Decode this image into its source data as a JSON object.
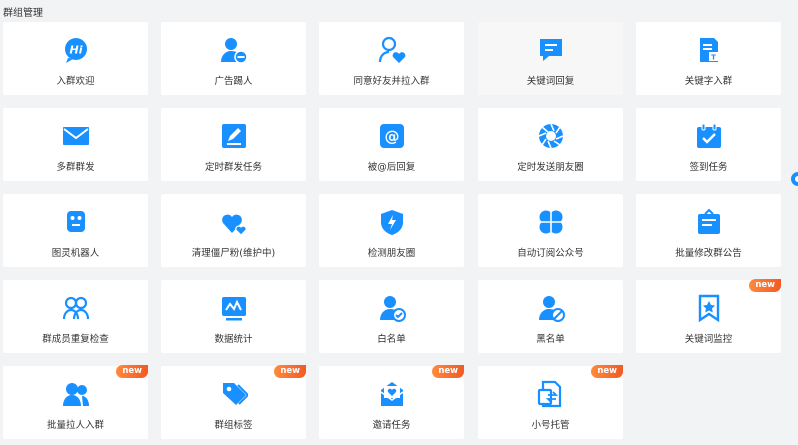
{
  "page": {
    "title": "群组管理"
  },
  "accent": "#1890ff",
  "badge_color": "#f15a24",
  "cards": [
    {
      "label": "入群欢迎",
      "icon": "hi-bubble-icon",
      "badge": ""
    },
    {
      "label": "广告踢人",
      "icon": "user-minus-icon",
      "badge": ""
    },
    {
      "label": "同意好友并拉入群",
      "icon": "user-heart-icon",
      "badge": ""
    },
    {
      "label": "关键词回复",
      "icon": "chat-bubble-icon",
      "badge": ""
    },
    {
      "label": "关键字入群",
      "icon": "document-text-icon",
      "badge": ""
    },
    {
      "label": "多群群发",
      "icon": "mail-icon",
      "badge": ""
    },
    {
      "label": "定时群发任务",
      "icon": "edit-square-icon",
      "badge": ""
    },
    {
      "label": "被@后回复",
      "icon": "at-sign-icon",
      "badge": ""
    },
    {
      "label": "定时发送朋友圈",
      "icon": "aperture-icon",
      "badge": ""
    },
    {
      "label": "签到任务",
      "icon": "calendar-check-icon",
      "badge": ""
    },
    {
      "label": "图灵机器人",
      "icon": "robot-icon",
      "badge": ""
    },
    {
      "label": "清理僵尸粉(维护中)",
      "icon": "hearts-icon",
      "badge": ""
    },
    {
      "label": "检测朋友圈",
      "icon": "shield-bolt-icon",
      "badge": ""
    },
    {
      "label": "自动订阅公众号",
      "icon": "clover-icon",
      "badge": ""
    },
    {
      "label": "批量修改群公告",
      "icon": "notice-board-icon",
      "badge": ""
    },
    {
      "label": "群成员重复检查",
      "icon": "users-group-icon",
      "badge": ""
    },
    {
      "label": "数据统计",
      "icon": "chart-monitor-icon",
      "badge": ""
    },
    {
      "label": "白名单",
      "icon": "user-check-icon",
      "badge": ""
    },
    {
      "label": "黑名单",
      "icon": "user-block-icon",
      "badge": ""
    },
    {
      "label": "关键词监控",
      "icon": "star-bookmark-icon",
      "badge": "new"
    },
    {
      "label": "批量拉人入群",
      "icon": "users-add-icon",
      "badge": "new"
    },
    {
      "label": "群组标签",
      "icon": "tags-icon",
      "badge": "new"
    },
    {
      "label": "邀请任务",
      "icon": "invite-mail-icon",
      "badge": "new"
    },
    {
      "label": "小号托管",
      "icon": "swap-doc-icon",
      "badge": "new"
    }
  ]
}
